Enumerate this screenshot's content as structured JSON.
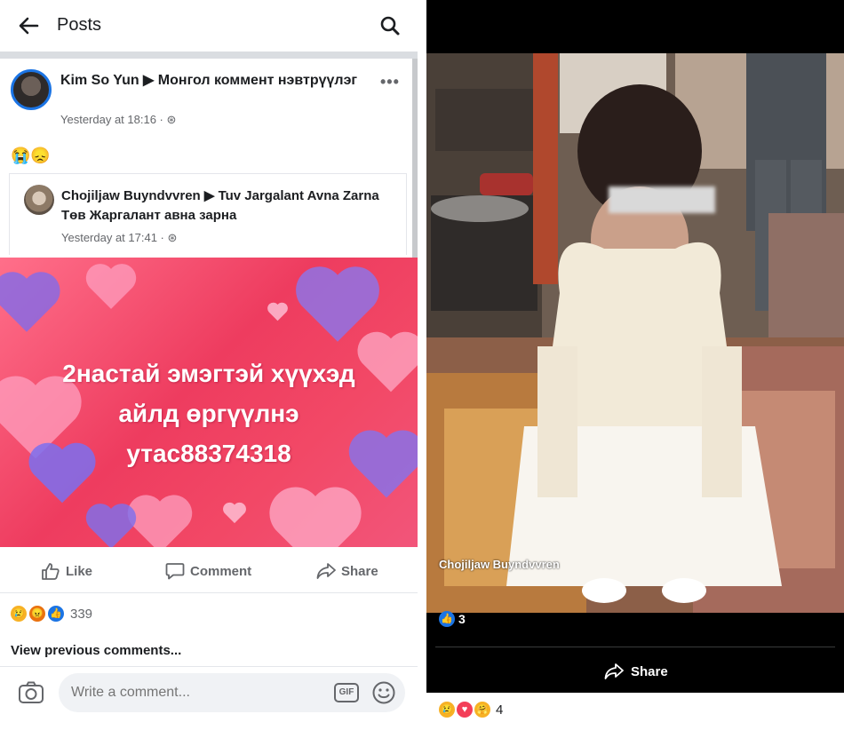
{
  "left_panel": {
    "header": {
      "title": "Posts",
      "back_icon": "back-arrow-icon",
      "search_icon": "search-icon"
    },
    "post": {
      "author_line": "Kim So Yun ▶ Монгол коммент нэвтрүүлэг",
      "timestamp": "Yesterday at 18:16 · ⊛",
      "emojis": "😭😞",
      "shared": {
        "author_line": "Chojiljaw Buyndvvren ▶ Tuv Jargalant Avna Zarna Төв Жаргалант авна зарна",
        "timestamp": "Yesterday at 17:41 · ⊛"
      },
      "image_text_lines": [
        "2настай эмэгтэй хүүхэд",
        "айлд өргүүлнэ",
        "утас88374318"
      ]
    },
    "actions": {
      "like": "Like",
      "comment": "Comment",
      "share": "Share"
    },
    "reactions": {
      "count": "339"
    },
    "view_previous": "View previous comments...",
    "comment_box": {
      "placeholder": "Write a comment...",
      "gif_label": "GIF"
    }
  },
  "right_panel": {
    "watermark": "Chojiljaw Buyndvvren",
    "like_count": "3",
    "share_label": "Share",
    "footer_reaction_count": "4"
  },
  "colors": {
    "facebook_blue": "#1b74e4",
    "secondary_text": "#65676b",
    "heart_background": "#ee3c5f"
  }
}
